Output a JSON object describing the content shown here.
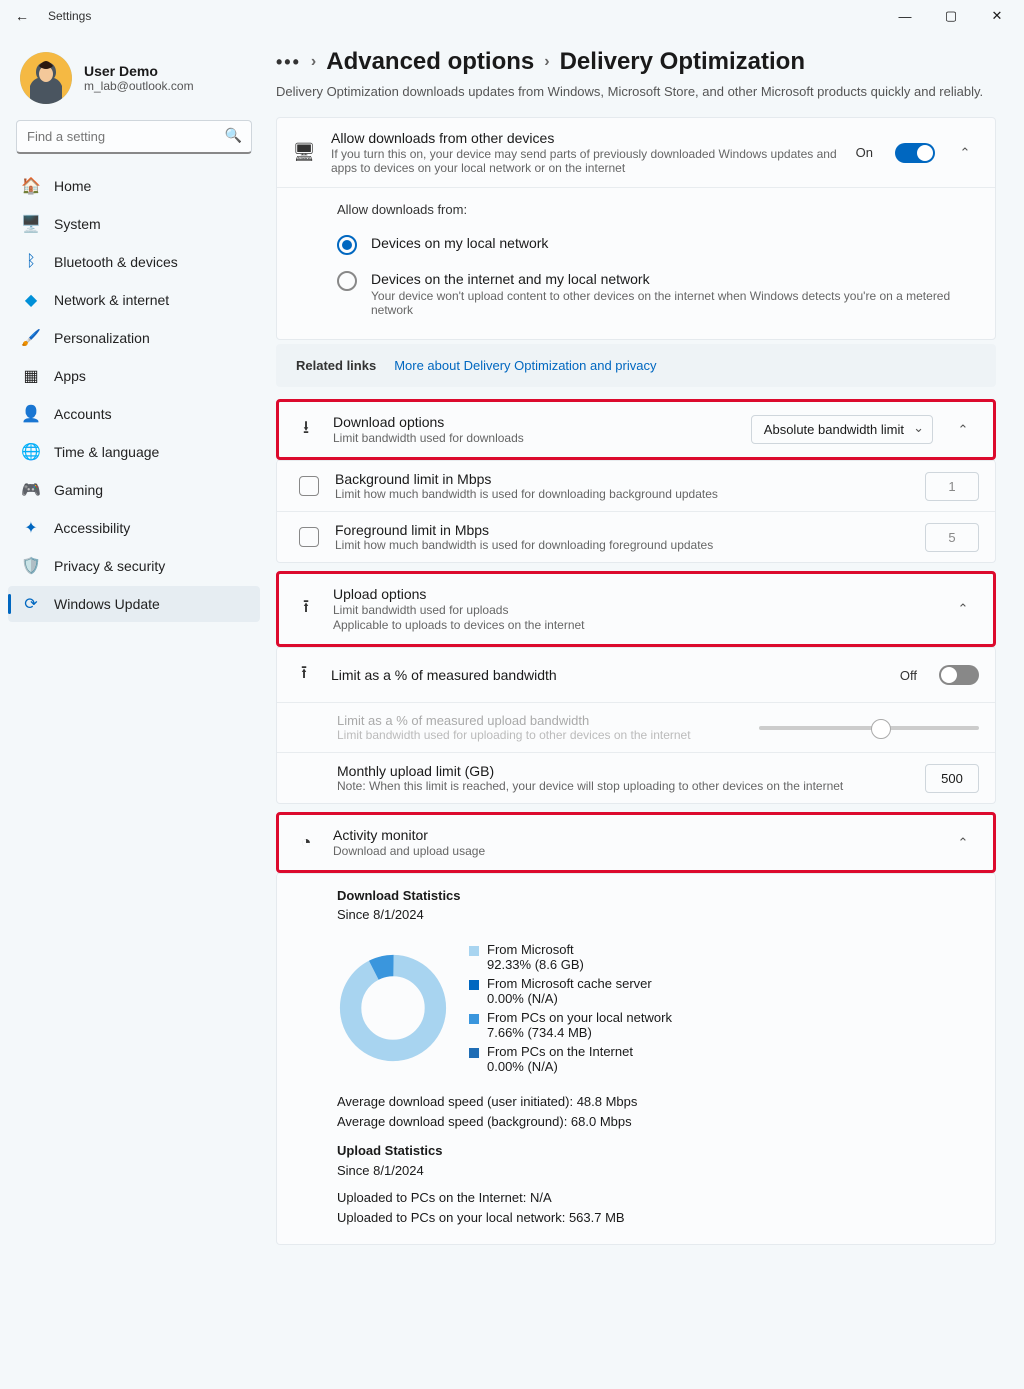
{
  "window": {
    "title": "Settings"
  },
  "user": {
    "name": "User Demo",
    "email": "m_lab@outlook.com"
  },
  "search": {
    "placeholder": "Find a setting"
  },
  "nav": {
    "home": "Home",
    "system": "System",
    "bluetooth": "Bluetooth & devices",
    "network": "Network & internet",
    "personalization": "Personalization",
    "apps": "Apps",
    "accounts": "Accounts",
    "time": "Time & language",
    "gaming": "Gaming",
    "accessibility": "Accessibility",
    "privacy": "Privacy & security",
    "windowsupdate": "Windows Update"
  },
  "breadcrumb": {
    "advanced": "Advanced options",
    "current": "Delivery Optimization"
  },
  "desc": "Delivery Optimization downloads updates from Windows, Microsoft Store, and other Microsoft products quickly and reliably.",
  "allow": {
    "title": "Allow downloads from other devices",
    "desc": "If you turn this on, your device may send parts of previously downloaded Windows updates and apps to devices on your local network or on the internet",
    "state": "On",
    "from": "Allow downloads from:",
    "opt1": "Devices on my local network",
    "opt2": "Devices on the internet and my local network",
    "opt2desc": "Your device won't upload content to other devices on the internet when Windows detects you're on a metered network"
  },
  "related": {
    "label": "Related links",
    "link": "More about Delivery Optimization and privacy"
  },
  "download": {
    "title": "Download options",
    "desc": "Limit bandwidth used for downloads",
    "dropdown": "Absolute bandwidth limit",
    "bg_title": "Background limit in Mbps",
    "bg_desc": "Limit how much bandwidth is used for downloading background updates",
    "bg_val": "1",
    "fg_title": "Foreground limit in Mbps",
    "fg_desc": "Limit how much bandwidth is used for downloading foreground updates",
    "fg_val": "5"
  },
  "upload": {
    "title": "Upload options",
    "desc": "Limit bandwidth used for uploads",
    "desc2": "Applicable to uploads to devices on the internet",
    "pct_title": "Limit as a % of measured bandwidth",
    "pct_state": "Off",
    "pct_dis_title": "Limit as a % of measured upload bandwidth",
    "pct_dis_desc": "Limit bandwidth used for uploading to other devices on the internet",
    "monthly_title": "Monthly upload limit (GB)",
    "monthly_desc": "Note: When this limit is reached, your device will stop uploading to other devices on the internet",
    "monthly_val": "500"
  },
  "activity": {
    "title": "Activity monitor",
    "desc": "Download and upload usage",
    "dlh": "Download Statistics",
    "since": "Since 8/1/2024",
    "leg1t": "From Microsoft",
    "leg1v": "92.33%  (8.6 GB)",
    "leg2t": "From Microsoft cache server",
    "leg2v": "0.00%  (N/A)",
    "leg3t": "From PCs on your local network",
    "leg3v": "7.66%  (734.4 MB)",
    "leg4t": "From PCs on the Internet",
    "leg4v": "0.00%  (N/A)",
    "avg1": "Average download speed (user initiated):   48.8 Mbps",
    "avg2": "Average download speed (background):   68.0 Mbps",
    "uph": "Upload Statistics",
    "upsince": "Since 8/1/2024",
    "up1": "Uploaded to PCs on the Internet: N/A",
    "up2": "Uploaded to PCs on your local network: 563.7 MB"
  },
  "chart_data": {
    "type": "pie",
    "title": "Download Statistics",
    "series": [
      {
        "name": "From Microsoft",
        "value": 92.33,
        "color": "#a8d4f0"
      },
      {
        "name": "From Microsoft cache server",
        "value": 0.0,
        "color": "#0067c0"
      },
      {
        "name": "From PCs on your local network",
        "value": 7.66,
        "color": "#3a96dd"
      },
      {
        "name": "From PCs on the Internet",
        "value": 0.0,
        "color": "#1f6db5"
      }
    ]
  }
}
